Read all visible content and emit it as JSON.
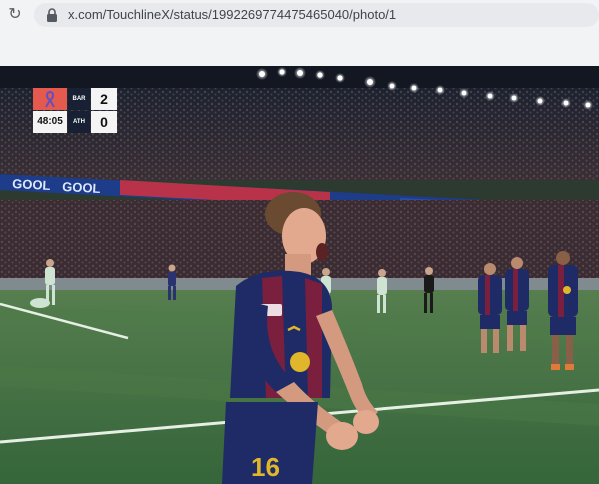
{
  "browser": {
    "url": "x.com/TouchlineX/status/1992269774475465040/photo/1"
  },
  "scoreboard": {
    "home_team": "BAR",
    "away_team": "ATH",
    "home_score": "2",
    "away_score": "0",
    "match_time": "48:05"
  },
  "photo": {
    "ad_board_text": "GOOL",
    "shirt_number": "16"
  },
  "colors": {
    "home_kit": "#1f2b66",
    "home_stripe": "#7a1f3d",
    "away_kit": "#cfe3d3",
    "pitch": "#3f6e3f"
  }
}
